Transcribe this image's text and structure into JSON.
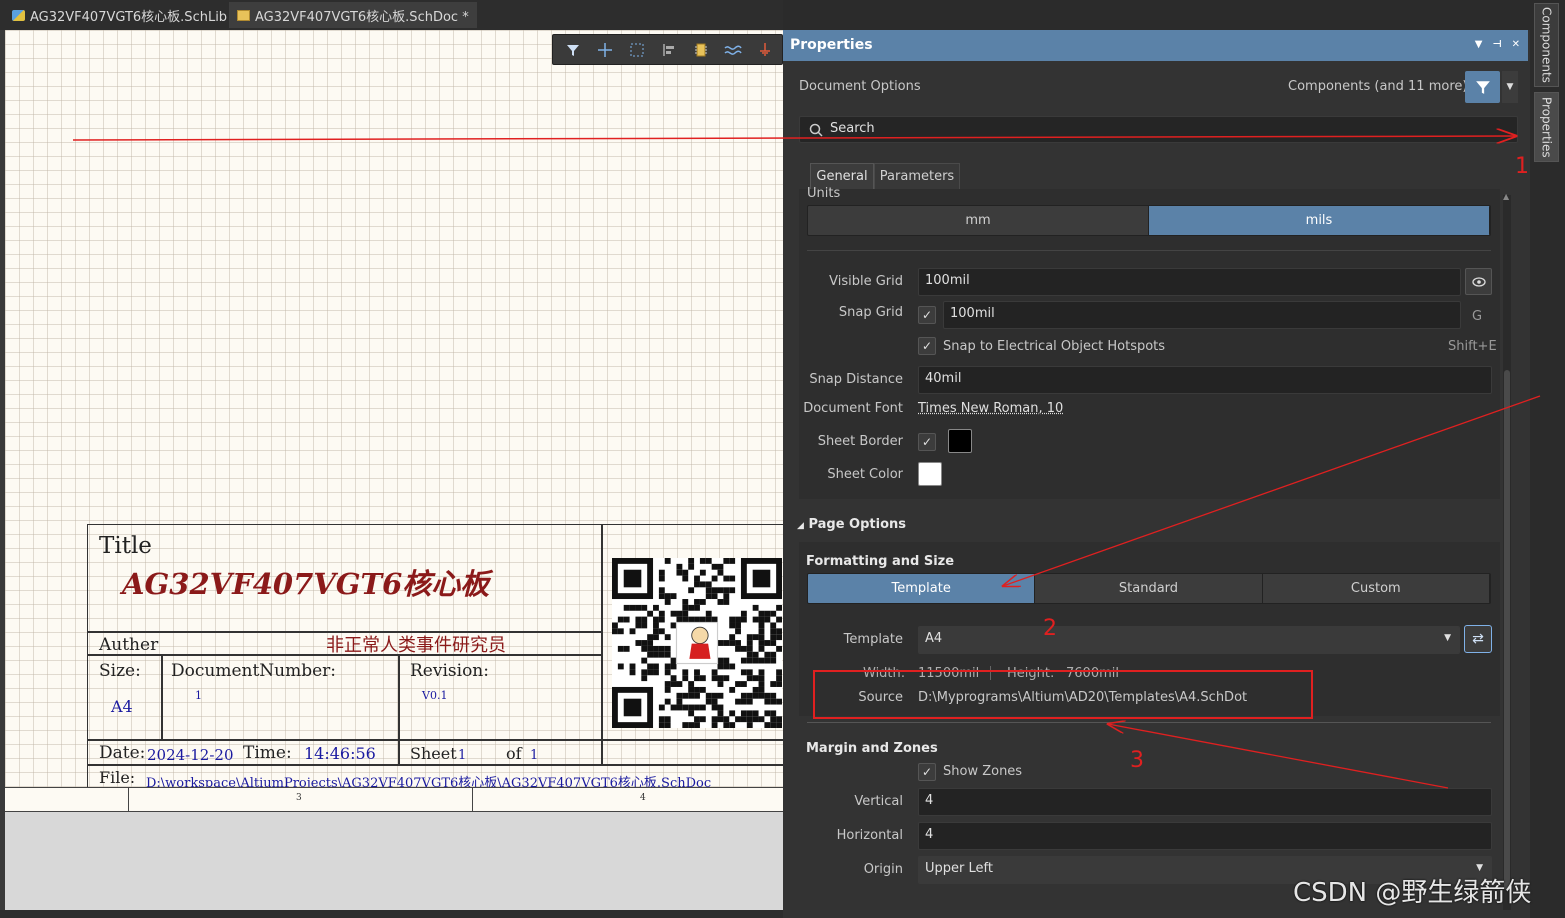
{
  "tabs": [
    {
      "label": "AG32VF407VGT6核心板.SchLib"
    },
    {
      "label": "AG32VF407VGT6核心板.SchDoc *"
    }
  ],
  "title_block": {
    "title_label": "Title",
    "title_value": "AG32VF407VGT6核心板",
    "author_label": "Auther",
    "author_value": "非正常人类事件研究员",
    "size_label": "Size:",
    "size_value": "A4",
    "docnum_label": "DocumentNumber:",
    "docnum_value": "1",
    "revision_label": "Revision:",
    "revision_value": "V0.1",
    "date_label": "Date:",
    "date_value": "2024-12-20",
    "time_label": "Time:",
    "time_value": "14:46:56",
    "sheet_label": "Sheet",
    "sheet_value": "1",
    "of_label": "of",
    "of_value": "1",
    "file_label": "File:",
    "file_value": "D:\\workspace\\AltiumProjects\\AG32VF407VGT6核心板\\AG32VF407VGT6核心板.SchDoc"
  },
  "zones": {
    "z3": "3",
    "z4": "4"
  },
  "properties": {
    "header": "Properties",
    "doc_options": "Document Options",
    "filter_text": "Components (and 11 more)",
    "search_placeholder": "Search",
    "tab_general": "General",
    "tab_parameters": "Parameters",
    "units_label": "Units",
    "unit_mm": "mm",
    "unit_mils": "mils",
    "visible_grid_label": "Visible Grid",
    "visible_grid_value": "100mil",
    "snap_grid_label": "Snap Grid",
    "snap_grid_value": "100mil",
    "snap_grid_shortcut": "G",
    "snap_hotspots_label": "Snap to Electrical Object Hotspots",
    "snap_hotspots_shortcut": "Shift+E",
    "snap_distance_label": "Snap Distance",
    "snap_distance_value": "40mil",
    "doc_font_label": "Document Font",
    "doc_font_value": "Times New Roman, 10",
    "sheet_border_label": "Sheet Border",
    "sheet_color_label": "Sheet Color",
    "page_options": "Page Options",
    "formatting_size": "Formatting and Size",
    "fmt_template": "Template",
    "fmt_standard": "Standard",
    "fmt_custom": "Custom",
    "template_label": "Template",
    "template_value": "A4",
    "width_label": "Width:",
    "width_value": "11500mil",
    "height_label": "Height:",
    "height_value": "7600mil",
    "source_label": "Source",
    "source_value": "D:\\Myprograms\\Altium\\AD20\\Templates\\A4.SchDot",
    "margin_zones": "Margin and Zones",
    "show_zones_label": "Show Zones",
    "vertical_label": "Vertical",
    "vertical_value": "4",
    "horizontal_label": "Horizontal",
    "horizontal_value": "4",
    "origin_label": "Origin",
    "origin_value": "Upper Left"
  },
  "rail": {
    "components": "Components",
    "properties": "Properties"
  },
  "annotations": {
    "a1": "1",
    "a2": "2",
    "a3": "3"
  },
  "watermark": "CSDN @野生绿箭侠",
  "colors": {
    "accent": "#5b82a8",
    "annotation": "#e02020",
    "title_red": "#8b1a1a",
    "link_blue": "#1a1aa0"
  }
}
